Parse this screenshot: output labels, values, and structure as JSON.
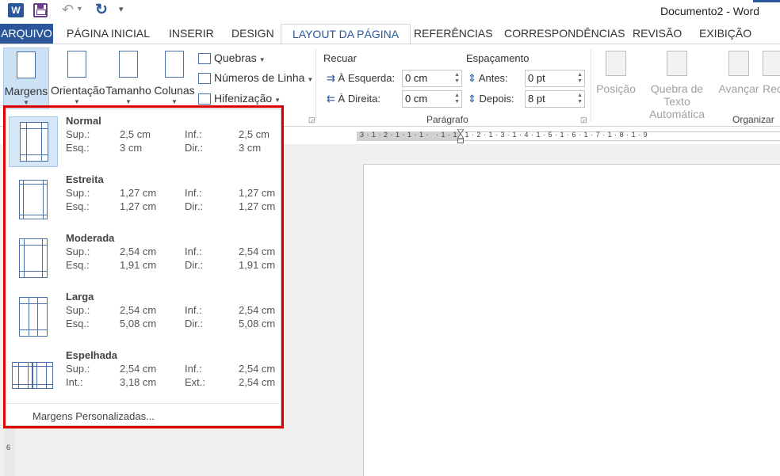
{
  "window": {
    "title": "Documento2 - Word",
    "app_icon": "word-icon"
  },
  "quick_access": {
    "icons": [
      "word-icon",
      "save-icon",
      "undo-icon",
      "redo-icon",
      "customize-icon"
    ]
  },
  "tabs": [
    {
      "label": "ARQUIVO"
    },
    {
      "label": "PÁGINA INICIAL"
    },
    {
      "label": "INSERIR"
    },
    {
      "label": "DESIGN"
    },
    {
      "label": "LAYOUT DA PÁGINA"
    },
    {
      "label": "REFERÊNCIAS"
    },
    {
      "label": "CORRESPONDÊNCIAS"
    },
    {
      "label": "REVISÃO"
    },
    {
      "label": "EXIBIÇÃO"
    }
  ],
  "ribbon": {
    "margins": "Margens",
    "orientation": "Orientação",
    "size": "Tamanho",
    "columns": "Colunas",
    "breaks": "Quebras",
    "line_numbers": "Números de Linha",
    "hyphenation": "Hifenização",
    "indent": {
      "heading": "Recuar",
      "left_label": "À Esquerda:",
      "left_value": "0 cm",
      "right_label": "À Direita:",
      "right_value": "0 cm"
    },
    "spacing": {
      "heading": "Espaçamento",
      "before_label": "Antes:",
      "before_value": "0 pt",
      "after_label": "Depois:",
      "after_value": "8 pt"
    },
    "paragraph_group": "Parágrafo",
    "position": "Posição",
    "wrap_text_1": "Quebra de Texto",
    "wrap_text_2": "Automática",
    "bring_forward": "Avançar",
    "send_backward": "Rec",
    "arrange_group": "Organizar"
  },
  "ruler": {
    "text": "3 · 1 · 2 · 1 · 1 · 1 ·   · 1 · 1 · 1 · 2 · 1 · 3 · 1 · 4 · 1 · 5 · 1 · 6 · 1 · 7 · 1 · 8 · 1 · 9",
    "vertical_mark": "6"
  },
  "margins_menu": {
    "options": [
      {
        "name": "Normal",
        "l1": "Sup.:",
        "v1": "2,5 cm",
        "l2": "Inf.:",
        "v2": "2,5 cm",
        "l3": "Esq.:",
        "v3": "3 cm",
        "l4": "Dir.:",
        "v4": "3 cm"
      },
      {
        "name": "Estreita",
        "l1": "Sup.:",
        "v1": "1,27 cm",
        "l2": "Inf.:",
        "v2": "1,27 cm",
        "l3": "Esq.:",
        "v3": "1,27 cm",
        "l4": "Dir.:",
        "v4": "1,27 cm"
      },
      {
        "name": "Moderada",
        "l1": "Sup.:",
        "v1": "2,54 cm",
        "l2": "Inf.:",
        "v2": "2,54 cm",
        "l3": "Esq.:",
        "v3": "1,91 cm",
        "l4": "Dir.:",
        "v4": "1,91 cm"
      },
      {
        "name": "Larga",
        "l1": "Sup.:",
        "v1": "2,54 cm",
        "l2": "Inf.:",
        "v2": "2,54 cm",
        "l3": "Esq.:",
        "v3": "5,08 cm",
        "l4": "Dir.:",
        "v4": "5,08 cm"
      },
      {
        "name": "Espelhada",
        "l1": "Sup.:",
        "v1": "2,54 cm",
        "l2": "Inf.:",
        "v2": "2,54 cm",
        "l3": "Int.:",
        "v3": "3,18 cm",
        "l4": "Ext.:",
        "v4": "2,54 cm"
      }
    ],
    "custom": "Margens Personalizadas..."
  },
  "colors": {
    "accent": "#2b579a",
    "highlight_frame": "#e00000",
    "selected_bg": "#cde1f5"
  }
}
